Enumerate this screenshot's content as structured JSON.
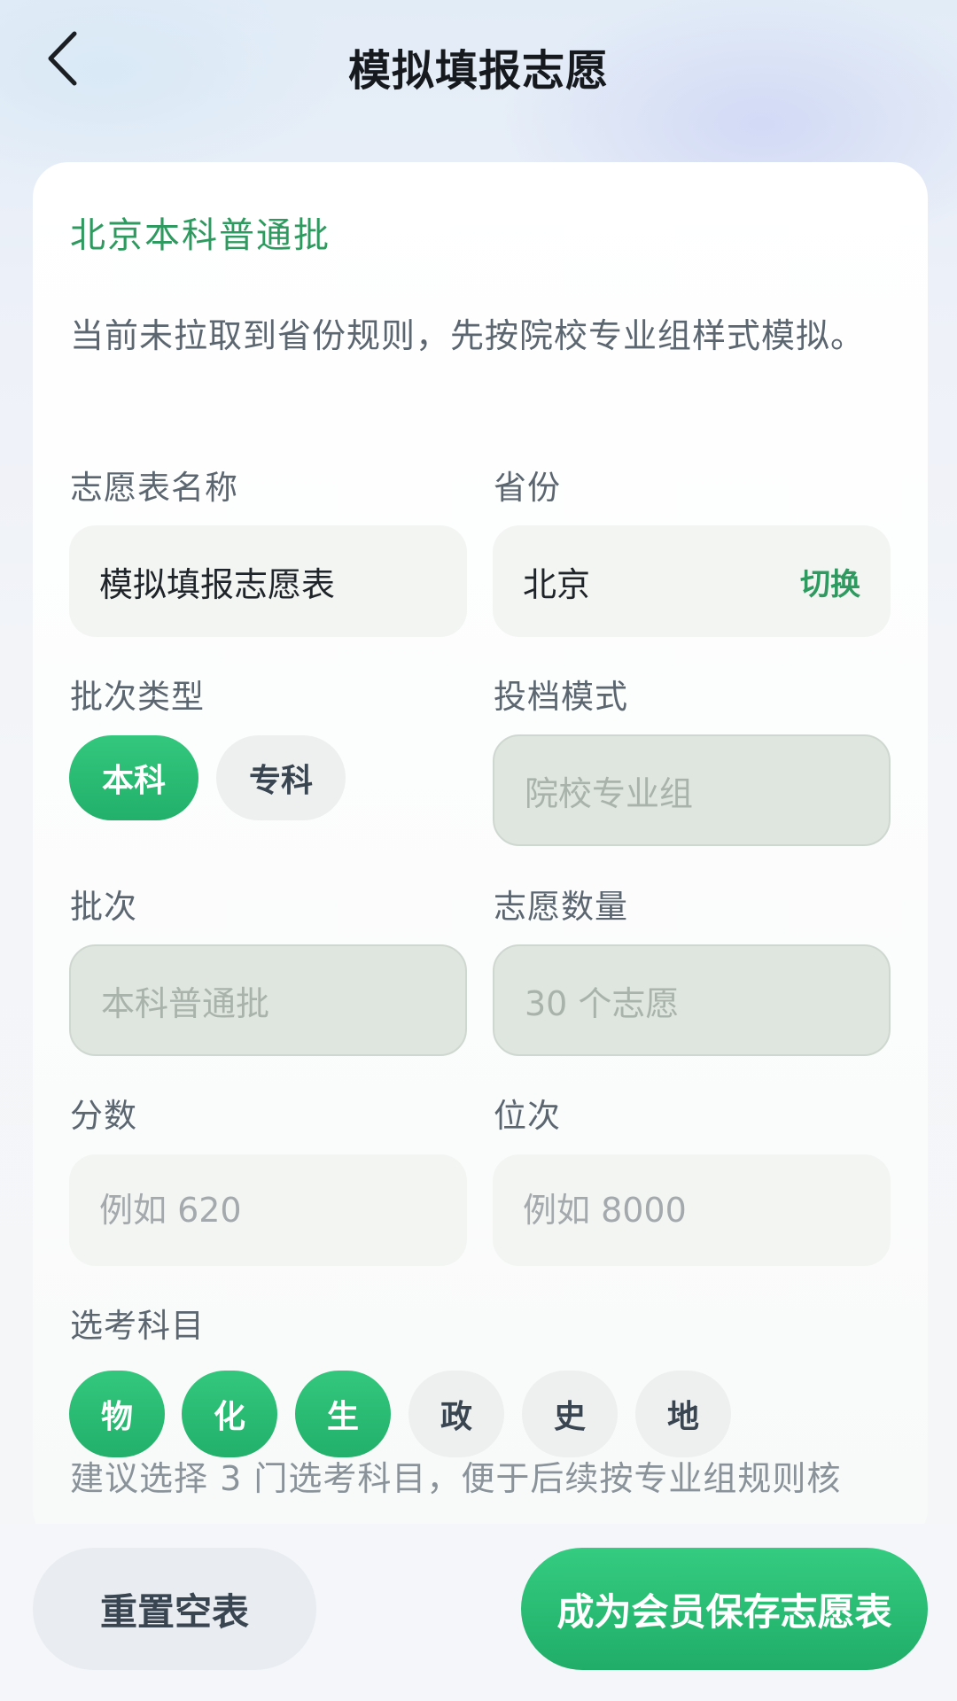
{
  "header": {
    "title": "模拟填报志愿",
    "back_icon": "chevron-left-icon"
  },
  "form": {
    "batch_heading": "北京本科普通批",
    "notice": "当前未拉取到省份规则，先按院校专业组样式模拟。",
    "name_label": "志愿表名称",
    "name_value": "模拟填报志愿表",
    "province_label": "省份",
    "province_value": "北京",
    "province_switch": "切换",
    "batch_type_label": "批次类型",
    "batch_types": [
      {
        "label": "本科",
        "selected": true
      },
      {
        "label": "专科",
        "selected": false
      }
    ],
    "mode_label": "投档模式",
    "mode_placeholder": "院校专业组",
    "batch_label": "批次",
    "batch_placeholder": "本科普通批",
    "count_label": "志愿数量",
    "count_placeholder": "30 个志愿",
    "score_label": "分数",
    "score_placeholder": "例如 620",
    "rank_label": "位次",
    "rank_placeholder": "例如 8000",
    "subjects_label": "选考科目",
    "subjects": [
      {
        "label": "物",
        "selected": true
      },
      {
        "label": "化",
        "selected": true
      },
      {
        "label": "生",
        "selected": true
      },
      {
        "label": "政",
        "selected": false
      },
      {
        "label": "史",
        "selected": false
      },
      {
        "label": "地",
        "selected": false
      }
    ],
    "hint": "建议选择 3 门选考科目，便于后续按专业组规则核"
  },
  "footer": {
    "reset_label": "重置空表",
    "save_label": "成为会员保存志愿表"
  },
  "colors": {
    "accent": "#2f9a5f",
    "primary_button": "#27b870"
  }
}
